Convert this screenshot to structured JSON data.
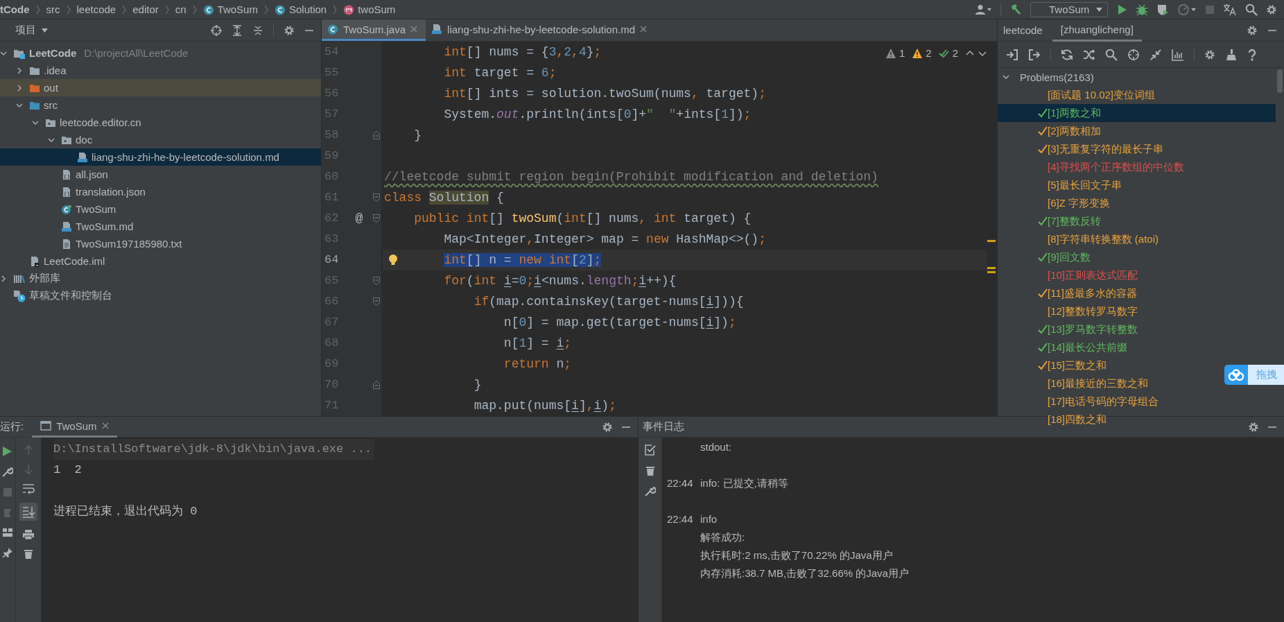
{
  "breadcrumb": [
    {
      "label": "tCode",
      "kind": "project"
    },
    {
      "label": "src",
      "kind": "folder"
    },
    {
      "label": "leetcode",
      "kind": "folder"
    },
    {
      "label": "editor",
      "kind": "folder"
    },
    {
      "label": "cn",
      "kind": "folder"
    },
    {
      "label": "TwoSum",
      "kind": "class"
    },
    {
      "label": "Solution",
      "kind": "class"
    },
    {
      "label": "twoSum",
      "kind": "method"
    }
  ],
  "run_config": {
    "label": "TwoSum"
  },
  "project_panel": {
    "title": "项目",
    "tree": [
      {
        "label": "LeetCode",
        "path": "D:\\projectAll\\LeetCode",
        "kind": "project",
        "expanded": true,
        "selected": false,
        "children": [
          {
            "label": ".idea",
            "kind": "folder",
            "expanded": false,
            "selected": false
          },
          {
            "label": "out",
            "kind": "excluded",
            "expanded": false,
            "selected": false
          },
          {
            "label": "src",
            "kind": "source",
            "expanded": true,
            "selected": false,
            "children": [
              {
                "label": "leetcode.editor.cn",
                "kind": "package",
                "expanded": true,
                "selected": false,
                "children": [
                  {
                    "label": "doc",
                    "kind": "package",
                    "expanded": true,
                    "selected": false,
                    "children": [
                      {
                        "label": "liang-shu-zhi-he-by-leetcode-solution.md",
                        "kind": "md",
                        "selected": true
                      }
                    ]
                  },
                  {
                    "label": "all.json",
                    "kind": "json",
                    "selected": false
                  },
                  {
                    "label": "translation.json",
                    "kind": "json",
                    "selected": false
                  },
                  {
                    "label": "TwoSum",
                    "kind": "class",
                    "selected": false
                  },
                  {
                    "label": "TwoSum.md",
                    "kind": "md",
                    "selected": false
                  },
                  {
                    "label": "TwoSum197185980.txt",
                    "kind": "txt",
                    "selected": false
                  }
                ]
              }
            ]
          },
          {
            "label": "LeetCode.iml",
            "kind": "iml",
            "selected": false
          }
        ]
      },
      {
        "label": "外部库",
        "kind": "library",
        "expanded": false,
        "selected": false
      },
      {
        "label": "草稿文件和控制台",
        "kind": "scratch",
        "selected": false
      }
    ]
  },
  "editor": {
    "tabs": [
      {
        "label": "TwoSum.java",
        "kind": "class",
        "selected": true
      },
      {
        "label": "liang-shu-zhi-he-by-leetcode-solution.md",
        "kind": "md",
        "selected": false
      }
    ],
    "inspections": [
      {
        "kind": "weak-warning",
        "count": "1"
      },
      {
        "kind": "warning",
        "count": "2"
      },
      {
        "kind": "typo",
        "count": "2"
      }
    ],
    "lines": [
      {
        "number": "54",
        "kind": "plain",
        "selected": false,
        "bulb": false,
        "tokens": [
          {
            "text": "        int",
            "kind": "kw"
          },
          {
            "text": "[] nums = {",
            "kind": "plain"
          },
          {
            "text": "3",
            "kind": "num"
          },
          {
            "text": ",",
            "kind": "kw"
          },
          {
            "text": "2",
            "kind": "num"
          },
          {
            "text": ",",
            "kind": "kw"
          },
          {
            "text": "4",
            "kind": "num"
          },
          {
            "text": "}",
            "kind": "plain"
          },
          {
            "text": ";",
            "kind": "kw"
          }
        ]
      },
      {
        "number": "55",
        "kind": "plain",
        "selected": false,
        "bulb": false,
        "tokens": [
          {
            "text": "        int",
            "kind": "kw"
          },
          {
            "text": " target = ",
            "kind": "plain"
          },
          {
            "text": "6",
            "kind": "num"
          },
          {
            "text": ";",
            "kind": "kw"
          }
        ]
      },
      {
        "number": "56",
        "kind": "plain",
        "selected": false,
        "bulb": false,
        "tokens": [
          {
            "text": "        int",
            "kind": "kw"
          },
          {
            "text": "[] ints = solution.twoSum(nums",
            "kind": "plain"
          },
          {
            "text": ",",
            "kind": "kw"
          },
          {
            "text": " target)",
            "kind": "plain"
          },
          {
            "text": ";",
            "kind": "kw"
          }
        ]
      },
      {
        "number": "57",
        "kind": "plain",
        "selected": false,
        "bulb": false,
        "tokens": [
          {
            "text": "        System.",
            "kind": "plain"
          },
          {
            "text": "out",
            "kind": "field"
          },
          {
            "text": ".println(ints[",
            "kind": "plain"
          },
          {
            "text": "0",
            "kind": "num"
          },
          {
            "text": "]+",
            "kind": "plain"
          },
          {
            "text": "\"  \"",
            "kind": "str"
          },
          {
            "text": "+ints[",
            "kind": "plain"
          },
          {
            "text": "1",
            "kind": "num"
          },
          {
            "text": "])",
            "kind": "plain"
          },
          {
            "text": ";",
            "kind": "kw"
          }
        ]
      },
      {
        "number": "58",
        "kind": "fold-end",
        "selected": false,
        "bulb": false,
        "tokens": [
          {
            "text": "    }",
            "kind": "plain"
          }
        ]
      },
      {
        "number": "59",
        "kind": "plain",
        "selected": false,
        "bulb": false
      },
      {
        "number": "60",
        "kind": "plain",
        "selected": false,
        "bulb": false,
        "tokens": [
          {
            "text": "//leetcode submit region begin(Prohibit modification and deletion)",
            "kind": "comment"
          }
        ]
      },
      {
        "number": "61",
        "kind": "fold-start",
        "selected": false,
        "bulb": false,
        "tokens": [
          {
            "text": "class ",
            "kind": "kw"
          },
          {
            "text": "Solution",
            "kind": "highlight"
          },
          {
            "text": " {",
            "kind": "plain"
          }
        ]
      },
      {
        "number": "62",
        "kind": "fold-start",
        "selected": false,
        "bulb": false,
        "marker": "@",
        "tokens": [
          {
            "text": "    public int",
            "kind": "kw"
          },
          {
            "text": "[] ",
            "kind": "plain"
          },
          {
            "text": "twoSum",
            "kind": "method"
          },
          {
            "text": "(",
            "kind": "plain"
          },
          {
            "text": "int",
            "kind": "kw"
          },
          {
            "text": "[] nums",
            "kind": "plain"
          },
          {
            "text": ", int",
            "kind": "kw"
          },
          {
            "text": " target) {",
            "kind": "plain"
          }
        ]
      },
      {
        "number": "63",
        "kind": "plain",
        "selected": false,
        "bulb": false,
        "tokens": [
          {
            "text": "        Map<Integer",
            "kind": "plain"
          },
          {
            "text": ",",
            "kind": "kw"
          },
          {
            "text": "Integer> map = ",
            "kind": "plain"
          },
          {
            "text": "new",
            "kind": "kw"
          },
          {
            "text": " HashMap<>()",
            "kind": "plain"
          },
          {
            "text": ";",
            "kind": "kw"
          }
        ]
      },
      {
        "number": "64",
        "kind": "plain",
        "selected": true,
        "bulb": true,
        "tokens": [
          {
            "text": "        int",
            "kind": "kw"
          },
          {
            "text": "[] n = ",
            "kind": "plain"
          },
          {
            "text": "new int",
            "kind": "kw"
          },
          {
            "text": "[",
            "kind": "plain"
          },
          {
            "text": "2",
            "kind": "num"
          },
          {
            "text": "]",
            "kind": "plain"
          },
          {
            "text": ";",
            "kind": "kw"
          }
        ]
      },
      {
        "number": "65",
        "kind": "fold-start",
        "selected": false,
        "bulb": false,
        "tokens": [
          {
            "text": "        for",
            "kind": "kw"
          },
          {
            "text": "(",
            "kind": "plain"
          },
          {
            "text": "int ",
            "kind": "kw"
          },
          {
            "text": "i",
            "kind": "var"
          },
          {
            "text": "=",
            "kind": "plain"
          },
          {
            "text": "0",
            "kind": "num"
          },
          {
            "text": ";",
            "kind": "kw"
          },
          {
            "text": "i",
            "kind": "var"
          },
          {
            "text": "<nums.",
            "kind": "plain"
          },
          {
            "text": "length",
            "kind": "member"
          },
          {
            "text": ";",
            "kind": "kw"
          },
          {
            "text": "i",
            "kind": "var"
          },
          {
            "text": "++){",
            "kind": "plain"
          }
        ]
      },
      {
        "number": "66",
        "kind": "fold-start",
        "selected": false,
        "bulb": false,
        "tokens": [
          {
            "text": "            if",
            "kind": "kw"
          },
          {
            "text": "(map.containsKey(target-nums[",
            "kind": "plain"
          },
          {
            "text": "i",
            "kind": "var"
          },
          {
            "text": "])){",
            "kind": "plain"
          }
        ]
      },
      {
        "number": "67",
        "kind": "plain",
        "selected": false,
        "bulb": false,
        "tokens": [
          {
            "text": "                n[",
            "kind": "plain"
          },
          {
            "text": "0",
            "kind": "num"
          },
          {
            "text": "] = map.get(target-nums[",
            "kind": "plain"
          },
          {
            "text": "i",
            "kind": "var"
          },
          {
            "text": "])",
            "kind": "plain"
          },
          {
            "text": ";",
            "kind": "kw"
          }
        ]
      },
      {
        "number": "68",
        "kind": "plain",
        "selected": false,
        "bulb": false,
        "tokens": [
          {
            "text": "                n[",
            "kind": "plain"
          },
          {
            "text": "1",
            "kind": "num"
          },
          {
            "text": "] = ",
            "kind": "plain"
          },
          {
            "text": "i",
            "kind": "var"
          },
          {
            "text": ";",
            "kind": "kw"
          }
        ]
      },
      {
        "number": "69",
        "kind": "plain",
        "selected": false,
        "bulb": false,
        "tokens": [
          {
            "text": "                return",
            "kind": "kw"
          },
          {
            "text": " n",
            "kind": "plain"
          },
          {
            "text": ";",
            "kind": "kw"
          }
        ]
      },
      {
        "number": "70",
        "kind": "fold-end",
        "selected": false,
        "bulb": false,
        "tokens": [
          {
            "text": "            }",
            "kind": "plain"
          }
        ]
      },
      {
        "number": "71",
        "kind": "plain",
        "selected": false,
        "bulb": false,
        "tokens": [
          {
            "text": "            map.put(nums[",
            "kind": "plain"
          },
          {
            "text": "i",
            "kind": "var"
          },
          {
            "text": "]",
            "kind": "plain"
          },
          {
            "text": ",",
            "kind": "kw"
          },
          {
            "text": "i",
            "kind": "var"
          },
          {
            "text": ")",
            "kind": "plain"
          },
          {
            "text": ";",
            "kind": "kw"
          }
        ]
      }
    ]
  },
  "leetcode_panel": {
    "title": "leetcode",
    "tabs": [
      {
        "label": "[zhuanglicheng]",
        "selected": true
      }
    ],
    "root": {
      "label": "Problems(2163)",
      "expanded": true
    },
    "problems": [
      {
        "label": "[面试题 10.02]变位词组",
        "color": "#e8a33d",
        "solved": false,
        "selected": false
      },
      {
        "label": "[1]两数之和",
        "color": "#5fb85f",
        "solved": true,
        "selected": true
      },
      {
        "label": "[2]两数相加",
        "color": "#e8a33d",
        "solved": true,
        "selected": false
      },
      {
        "label": "[3]无重复字符的最长子串",
        "color": "#e8a33d",
        "solved": true,
        "selected": false
      },
      {
        "label": "[4]寻找两个正序数组的中位数",
        "color": "#e0504d",
        "solved": false,
        "selected": false
      },
      {
        "label": "[5]最长回文子串",
        "color": "#e8a33d",
        "solved": false,
        "selected": false
      },
      {
        "label": "[6]Z 字形变换",
        "color": "#e8a33d",
        "solved": false,
        "selected": false
      },
      {
        "label": "[7]整数反转",
        "color": "#5fb85f",
        "solved": true,
        "selected": false
      },
      {
        "label": "[8]字符串转换整数 (atoi)",
        "color": "#e8a33d",
        "solved": false,
        "selected": false
      },
      {
        "label": "[9]回文数",
        "color": "#5fb85f",
        "solved": true,
        "selected": false
      },
      {
        "label": "[10]正则表达式匹配",
        "color": "#e0504d",
        "solved": false,
        "selected": false
      },
      {
        "label": "[11]盛最多水的容器",
        "color": "#e8a33d",
        "solved": true,
        "selected": false
      },
      {
        "label": "[12]整数转罗马数字",
        "color": "#e8a33d",
        "solved": false,
        "selected": false
      },
      {
        "label": "[13]罗马数字转整数",
        "color": "#5fb85f",
        "solved": true,
        "selected": false
      },
      {
        "label": "[14]最长公共前缀",
        "color": "#5fb85f",
        "solved": true,
        "selected": false
      },
      {
        "label": "[15]三数之和",
        "color": "#e8a33d",
        "solved": true,
        "selected": false
      },
      {
        "label": "[16]最接近的三数之和",
        "color": "#e8a33d",
        "solved": false,
        "selected": false
      },
      {
        "label": "[17]电话号码的字母组合",
        "color": "#e8a33d",
        "solved": false,
        "selected": false
      },
      {
        "label": "[18]四数之和",
        "color": "#e8a33d",
        "solved": false,
        "selected": false
      }
    ]
  },
  "run_panel": {
    "title": "运行:",
    "tabs": [
      {
        "label": "TwoSum",
        "selected": true
      }
    ],
    "console": [
      {
        "text": "D:\\InstallSoftware\\jdk-8\\jdk\\bin\\java.exe ...",
        "kind": "command"
      },
      {
        "text": "1  2",
        "kind": "output"
      },
      {
        "text": "进程已结束，退出代码为 0",
        "kind": "system"
      }
    ]
  },
  "event_log": {
    "title": "事件日志",
    "entries": [
      {
        "lines": [
          "stdout:"
        ]
      },
      {
        "time": "22:44",
        "lines": [
          "info: 已提交,请稍等"
        ]
      },
      {
        "time": "22:44",
        "lines": [
          "info",
          "解答成功:",
          "执行耗时:2 ms,击败了70.22% 的Java用户",
          "内存消耗:38.7 MB,击败了32.66% 的Java用户"
        ]
      }
    ]
  },
  "floating_widget": {
    "label": "拖拽"
  }
}
